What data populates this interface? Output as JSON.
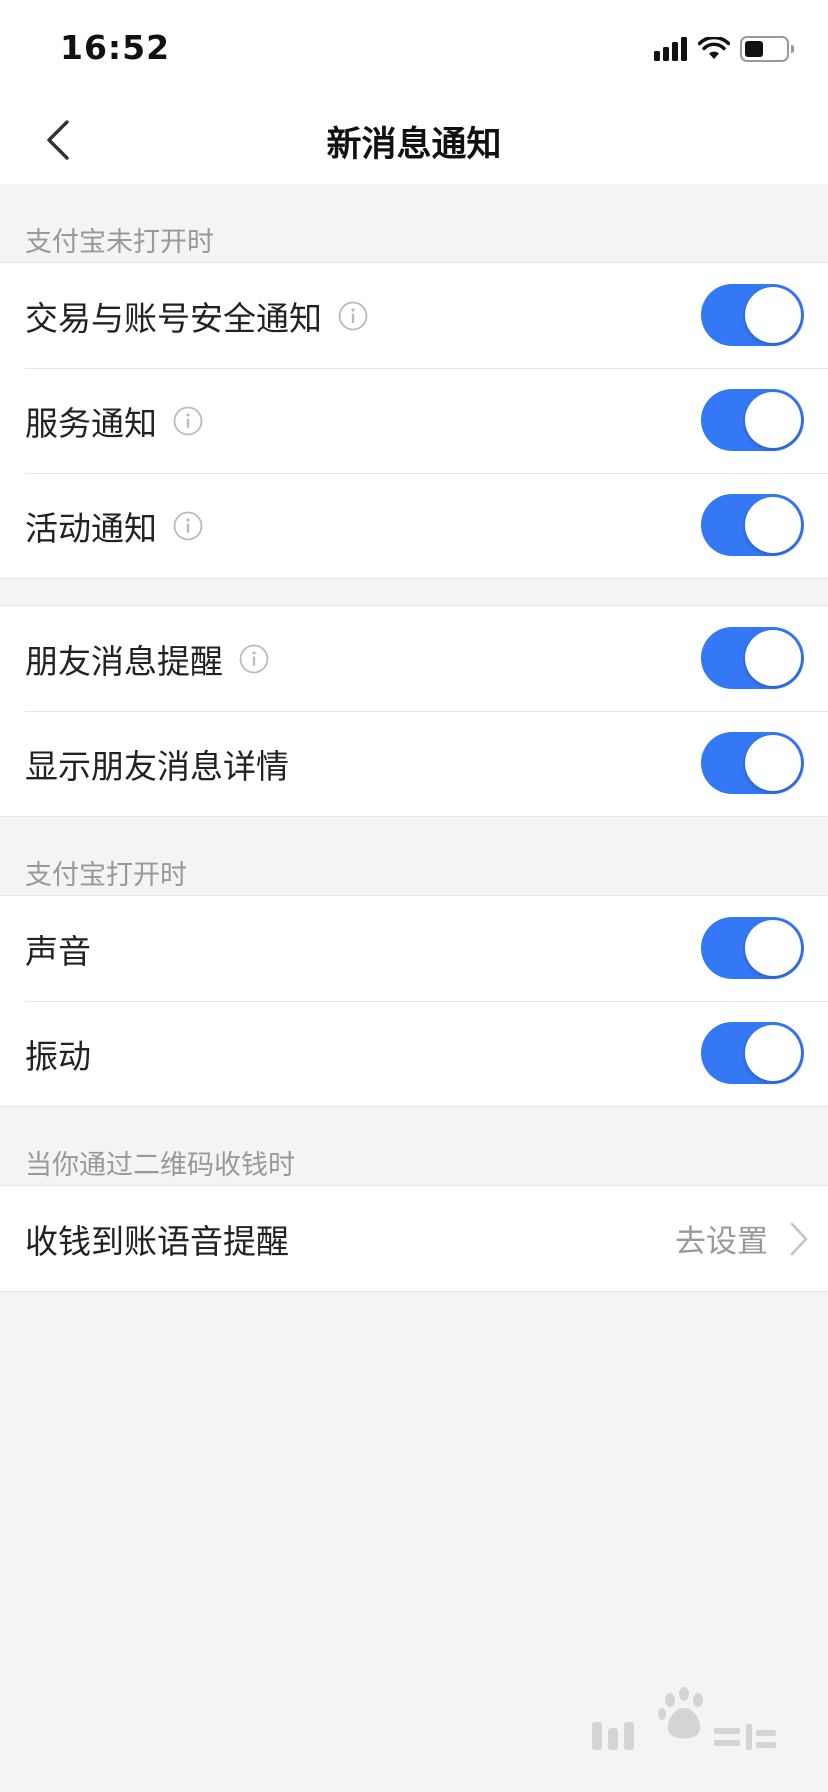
{
  "status_bar": {
    "time": "16:52"
  },
  "nav": {
    "title": "新消息通知"
  },
  "sections": [
    {
      "header": "支付宝未打开时",
      "rows": [
        {
          "label": "交易与账号安全通知",
          "info": true,
          "toggle_on": true
        },
        {
          "label": "服务通知",
          "info": true,
          "toggle_on": true
        },
        {
          "label": "活动通知",
          "info": true,
          "toggle_on": true
        }
      ]
    },
    {
      "header": "",
      "rows": [
        {
          "label": "朋友消息提醒",
          "info": true,
          "toggle_on": true
        },
        {
          "label": "显示朋友消息详情",
          "info": false,
          "toggle_on": true
        }
      ]
    },
    {
      "header": "支付宝打开时",
      "rows": [
        {
          "label": "声音",
          "info": false,
          "toggle_on": true
        },
        {
          "label": "振动",
          "info": false,
          "toggle_on": true
        }
      ]
    },
    {
      "header": "当你通过二维码收钱时",
      "rows": [
        {
          "label": "收钱到账语音提醒",
          "action_label": "去设置"
        }
      ]
    }
  ],
  "colors": {
    "toggle_on": "#3478f6",
    "background": "#f4f4f4",
    "secondary_text": "#999999"
  },
  "icons": {
    "back": "chevron-left-icon",
    "info": "info-circle-icon",
    "disclosure": "chevron-right-icon",
    "signal": "cellular-signal-icon",
    "wifi": "wifi-icon",
    "battery": "battery-icon"
  }
}
